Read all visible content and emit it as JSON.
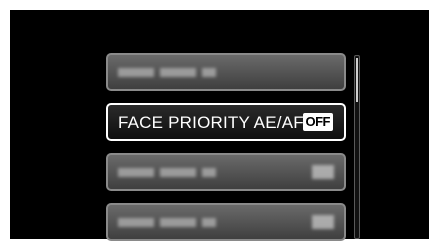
{
  "menu": {
    "items": [
      {
        "label": "",
        "obscured": true,
        "has_badge": false
      },
      {
        "label": "FACE PRIORITY AE/AF",
        "badge": "OFF",
        "selected": true
      },
      {
        "label": "",
        "obscured": true,
        "has_badge": true
      },
      {
        "label": "",
        "obscured": true,
        "has_badge": true
      }
    ]
  },
  "scroll": {
    "position_fraction": 0.0
  },
  "colors": {
    "background": "#000000",
    "item_border": "#8a8a8a",
    "selected_border": "#ffffff",
    "badge_bg": "#ffffff"
  }
}
